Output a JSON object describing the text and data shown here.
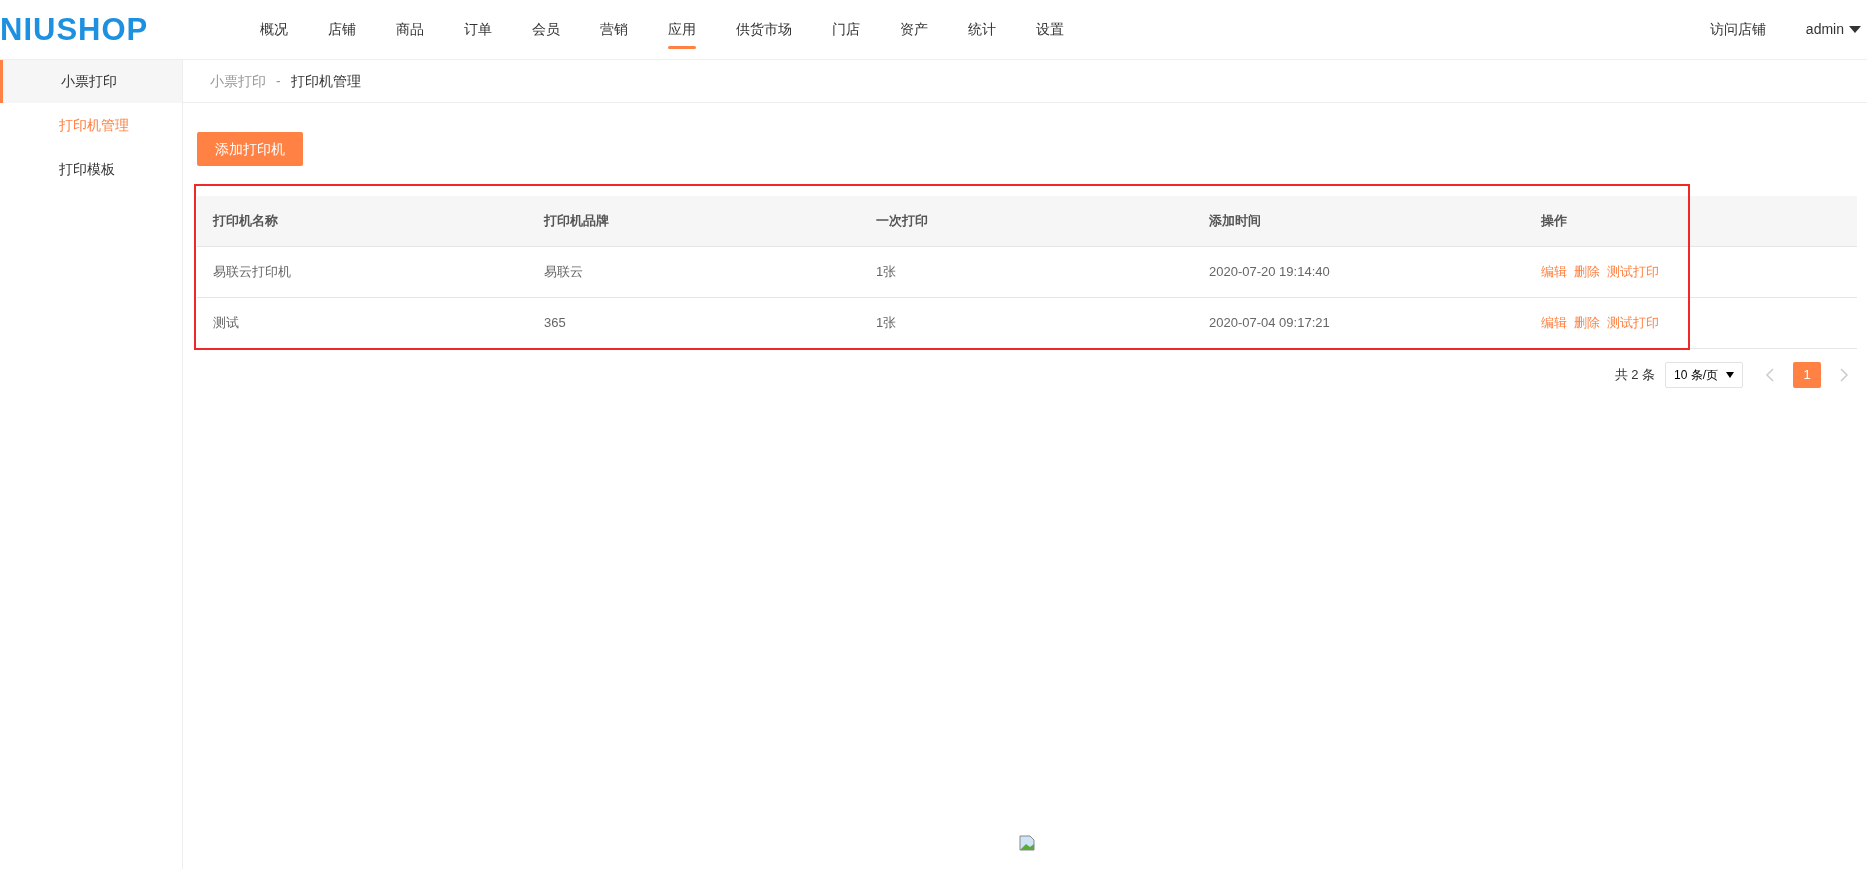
{
  "header": {
    "logo": "NIUSHOP",
    "nav": [
      {
        "label": "概况",
        "selected": false
      },
      {
        "label": "店铺",
        "selected": false
      },
      {
        "label": "商品",
        "selected": false
      },
      {
        "label": "订单",
        "selected": false
      },
      {
        "label": "会员",
        "selected": false
      },
      {
        "label": "营销",
        "selected": false
      },
      {
        "label": "应用",
        "selected": true
      },
      {
        "label": "供货市场",
        "selected": false
      },
      {
        "label": "门店",
        "selected": false
      },
      {
        "label": "资产",
        "selected": false
      },
      {
        "label": "统计",
        "selected": false
      },
      {
        "label": "设置",
        "selected": false
      }
    ],
    "visit_store": "访问店铺",
    "user": "admin"
  },
  "sidebar": {
    "title": "小票打印",
    "items": [
      {
        "label": "打印机管理",
        "selected": true
      },
      {
        "label": "打印模板",
        "selected": false
      }
    ]
  },
  "breadcrumb": [
    "小票打印",
    "-",
    "打印机管理"
  ],
  "add_button": "添加打印机",
  "table": {
    "columns": [
      "打印机名称",
      "打印机品牌",
      "一次打印",
      "添加时间",
      "操作"
    ],
    "rows": [
      {
        "name": "易联云打印机",
        "brand": "易联云",
        "per_print": "1张",
        "added": "2020-07-20 19:14:40",
        "actions": [
          "编辑",
          "删除",
          "测试打印"
        ]
      },
      {
        "name": "测试",
        "brand": "365",
        "per_print": "1张",
        "added": "2020-07-04 09:17:21",
        "actions": [
          "编辑",
          "删除",
          "测试打印"
        ]
      }
    ]
  },
  "pagination": {
    "total": "共 2 条",
    "page_size": "10 条/页",
    "pages": [
      {
        "label": "1",
        "selected": true
      }
    ]
  }
}
